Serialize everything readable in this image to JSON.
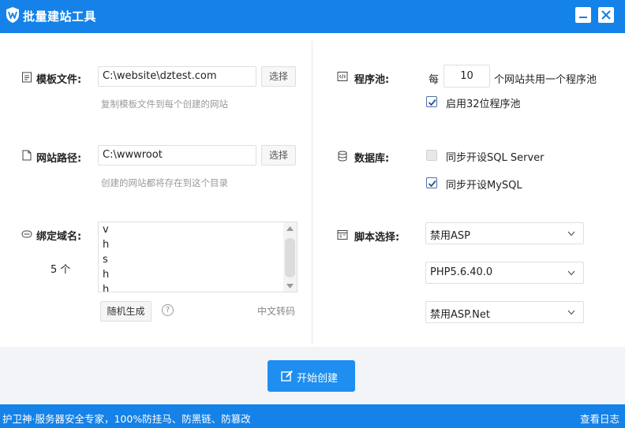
{
  "window": {
    "title": "批量建站工具",
    "accent": "#1482e8"
  },
  "template": {
    "label": "模板文件:",
    "icon": "document-icon",
    "value": "C:\\website\\dztest.com",
    "choose_label": "选择",
    "hint": "复制模板文件到每个创建的网站"
  },
  "site_path": {
    "label": "网站路径:",
    "icon": "file-icon",
    "value": "C:\\wwwroot",
    "choose_label": "选择",
    "hint": "创建的网站都将存在到这个目录"
  },
  "domains": {
    "label": "绑定域名:",
    "icon": "domain-icon",
    "lines": [
      "v",
      "h",
      "s",
      "h",
      "h"
    ],
    "count": "5 个",
    "generate_label": "随机生成",
    "help": "?",
    "encode_label": "中文转码"
  },
  "app_pool": {
    "label": "程序池:",
    "icon": "code-icon",
    "prefix": "每",
    "value": "10",
    "suffix": "个网站共用一个程序池",
    "enable32_label": "启用32位程序池",
    "enable32_checked": true
  },
  "database": {
    "label": "数据库:",
    "icon": "database-icon",
    "sqlserver_label": "同步开设SQL Server",
    "sqlserver_checked": false,
    "mysql_label": "同步开设MySQL",
    "mysql_checked": true
  },
  "script": {
    "label": "脚本选择:",
    "icon": "script-icon",
    "asp": "禁用ASP",
    "php": "PHP5.6.40.0",
    "aspnet": "禁用ASP.Net"
  },
  "actions": {
    "start_label": "开始创建"
  },
  "status": {
    "left_text": "护卫神·服务器安全专家，100%防挂马、防黑链、防篡改",
    "log_label": "查看日志"
  }
}
